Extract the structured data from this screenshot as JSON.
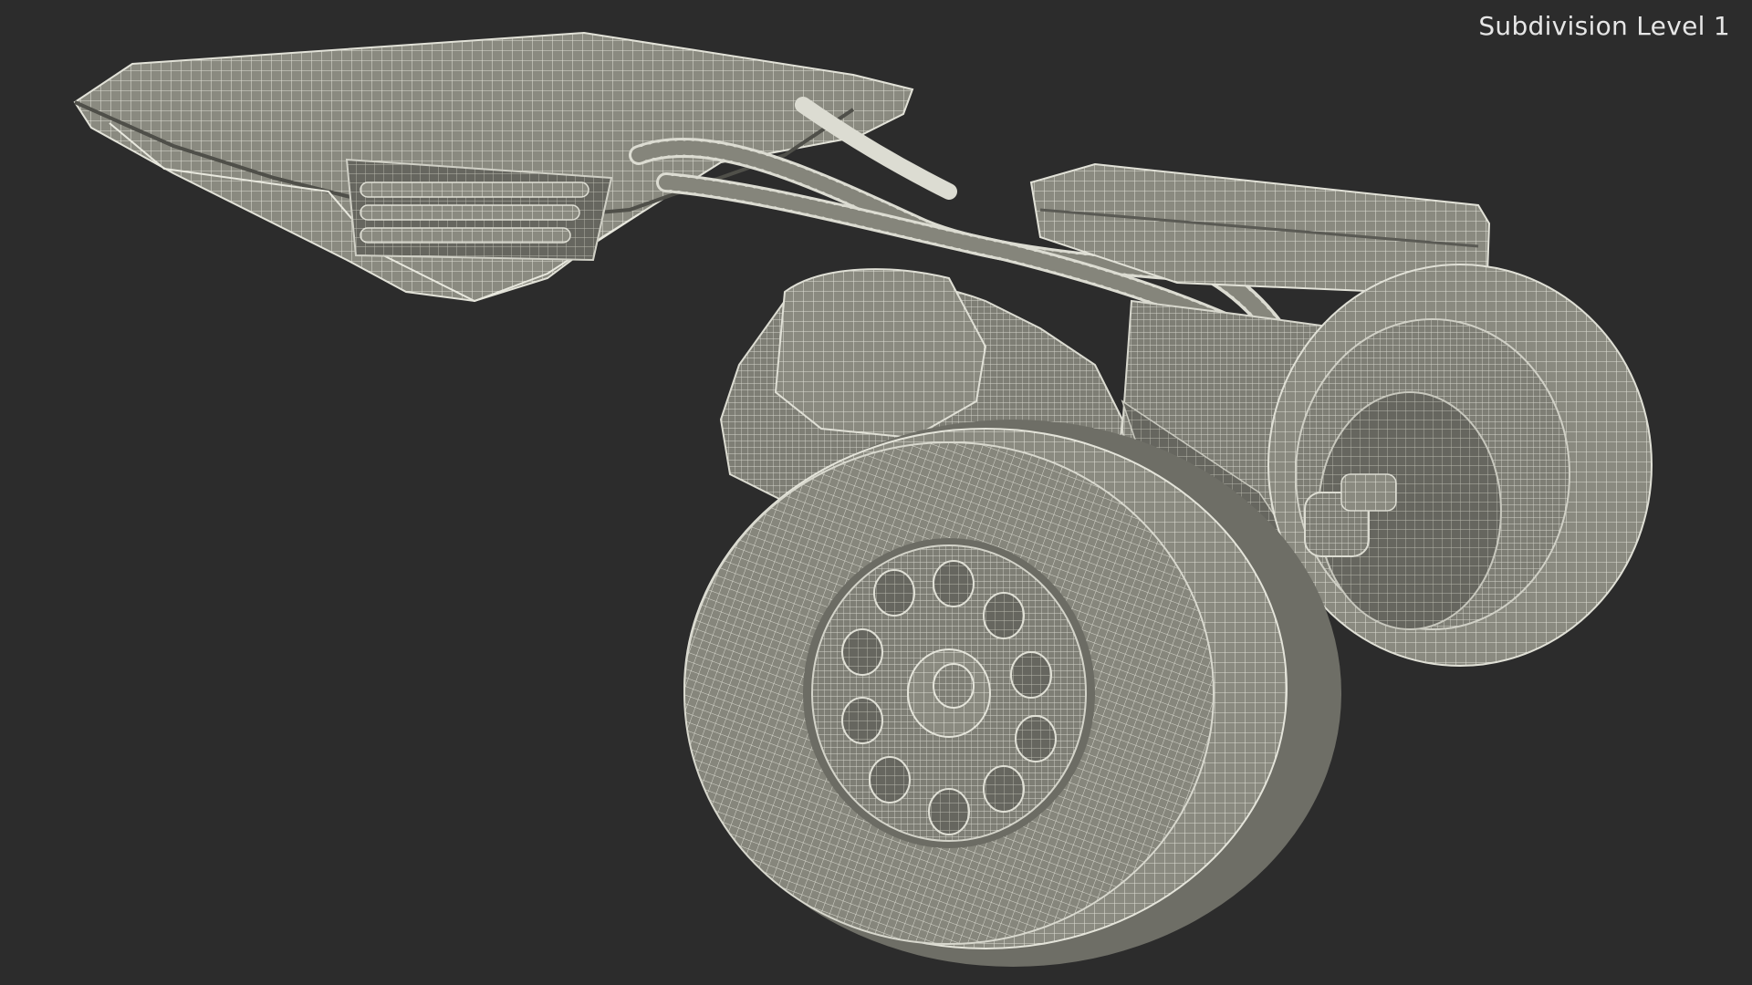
{
  "viewport": {
    "label": "Subdivision Level 1",
    "background": "#2c2c2c",
    "mesh_fill": "#8c8c82",
    "mesh_wire": "#d9d9cf",
    "mesh_shadow": "#5f5f58"
  }
}
